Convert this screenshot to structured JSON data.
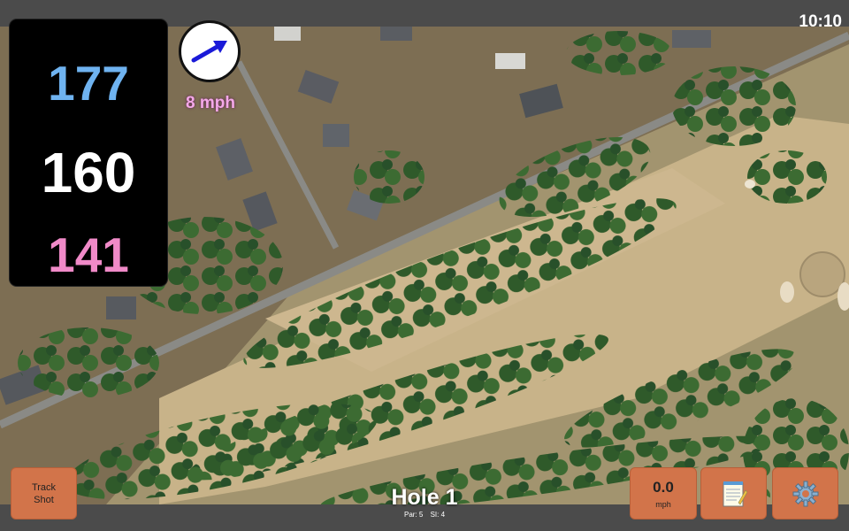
{
  "status": {
    "time": "10:10"
  },
  "distances": {
    "back": "177",
    "middle": "160",
    "front": "141"
  },
  "wind": {
    "speed": "8 mph",
    "icon": "wind-direction-arrow-icon"
  },
  "hole": {
    "title": "Hole 1",
    "par": "Par: 5",
    "stroke_index": "SI: 4"
  },
  "buttons": {
    "track_shot_line1": "Track",
    "track_shot_line2": "Shot",
    "speed_value": "0.0",
    "speed_unit": "mph",
    "notes_icon": "notepad-icon",
    "settings_icon": "gear-icon"
  },
  "colors": {
    "back_distance": "#6fb3f0",
    "middle_distance": "#ffffff",
    "front_distance": "#f08ac8",
    "button_orange": "#d2744a",
    "bar_gray": "#4b4b4b"
  }
}
